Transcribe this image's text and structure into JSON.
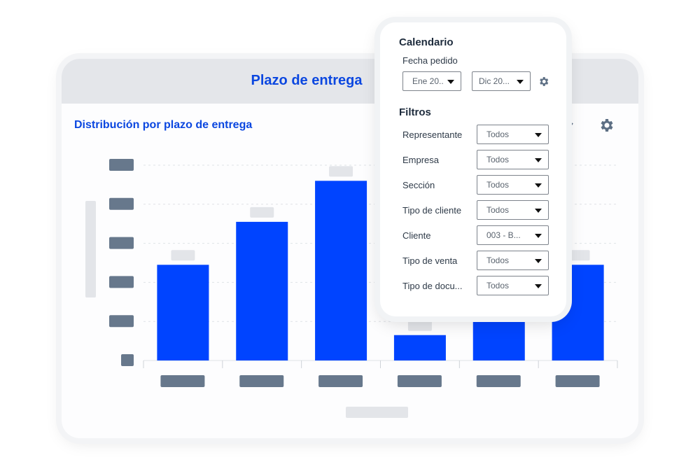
{
  "card": {
    "title": "Plazo de entrega",
    "chart_title": "Distribución por plazo de entrega"
  },
  "toolbar": {
    "download_icon": "chevron-down-icon",
    "settings_icon": "gear-icon"
  },
  "chart_data": {
    "type": "bar",
    "categories": [
      "",
      "",
      "",
      "",
      "",
      ""
    ],
    "values": [
      2.45,
      3.55,
      4.6,
      0.65,
      2.5,
      2.45
    ],
    "ylim": [
      0,
      5
    ],
    "title": "",
    "xlabel": "",
    "ylabel": "",
    "grid": true,
    "bar_color": "#0044ff",
    "note_labels_redacted": true
  },
  "panel": {
    "calendar_title": "Calendario",
    "date_label": "Fecha pedido",
    "date_from": "Ene 20..",
    "date_to": "Dic 20...",
    "filters_title": "Filtros",
    "filters": [
      {
        "label": "Representante",
        "value": "Todos"
      },
      {
        "label": "Empresa",
        "value": "Todos"
      },
      {
        "label": "Sección",
        "value": "Todos"
      },
      {
        "label": "Tipo de cliente",
        "value": "Todos"
      },
      {
        "label": "Cliente",
        "value": "003 - B..."
      },
      {
        "label": "Tipo de venta",
        "value": "Todos"
      },
      {
        "label": "Tipo de docu...",
        "value": "Todos"
      }
    ]
  },
  "colors": {
    "accent": "#0b47e0",
    "bar": "#0044ff",
    "placeholder": "#67788c"
  }
}
